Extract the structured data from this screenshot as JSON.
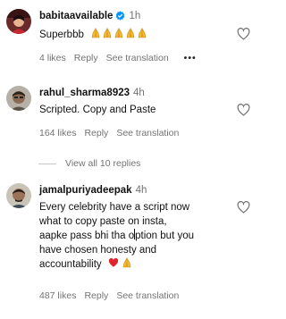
{
  "comments": [
    {
      "username": "babitaavailable",
      "time": "1h",
      "verified": true,
      "text": "Superbbb",
      "emoji": "folded-hands-emoji",
      "emoji_count": 5,
      "likes": "4 likes",
      "reply": "Reply",
      "translate": "See translation",
      "more": "•••"
    },
    {
      "username": "rahul_sharma8923",
      "time": "4h",
      "text": "Scripted. Copy and Paste",
      "likes": "164 likes",
      "reply": "Reply",
      "translate": "See translation"
    },
    {
      "username": "jamalpuriyadeepak",
      "time": "4h",
      "text_lines": [
        "Every celebrity have a script now",
        "what to copy paste on insta,",
        "aapke pass bhi tha option but you",
        "have chosen honesty and",
        "accountability"
      ],
      "emoji": [
        "red-heart-emoji",
        "folded-hands-emoji"
      ],
      "likes": "487 likes",
      "reply": "Reply",
      "translate": "See translation"
    }
  ],
  "view_replies": "View all 10 replies",
  "colors": {
    "meta": "#737373",
    "verified": "#0095f6",
    "heart_emoji": "#e0242c",
    "hands_emoji": "#f5b731"
  }
}
